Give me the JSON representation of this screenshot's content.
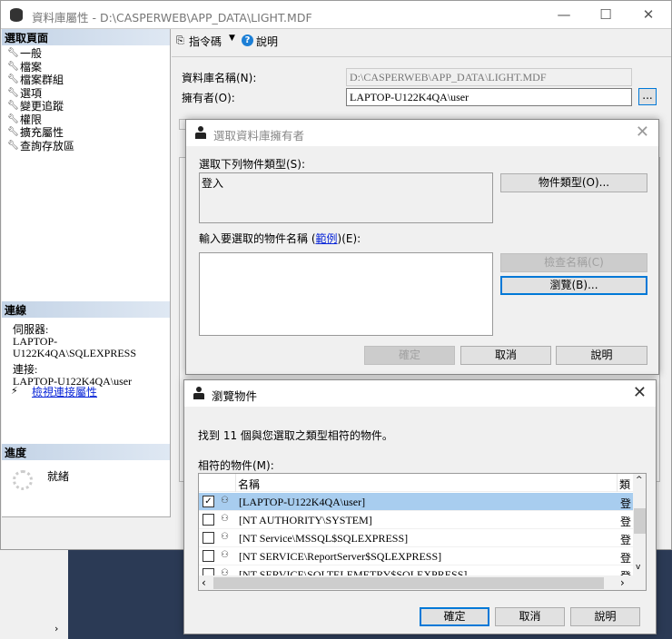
{
  "main_window": {
    "title": "資料庫屬性 - D:\\CASPERWEB\\APP_DATA\\LIGHT.MDF",
    "controls": {
      "minimize": "—",
      "maximize": "☐",
      "close": "✕"
    },
    "left_panel": {
      "select_page_header": "選取頁面",
      "pages": [
        "一般",
        "檔案",
        "檔案群組",
        "選項",
        "變更追蹤",
        "權限",
        "擴充屬性",
        "查詢存放區"
      ],
      "connection_header": "連線",
      "server_label": "伺服器:",
      "server_value": "LAPTOP-U122K4QA\\SQLEXPRESS",
      "connection_label": "連接:",
      "connection_value": "LAPTOP-U122K4QA\\user",
      "view_connection_link": "檢視連接屬性",
      "progress_header": "進度",
      "progress_status": "就緒"
    },
    "toolbar": {
      "script_label": "指令碼",
      "help_label": "說明"
    },
    "form": {
      "db_name_label": "資料庫名稱(N):",
      "db_name_value": "D:\\CASPERWEB\\APP_DATA\\LIGHT.MDF",
      "owner_label": "擁有者(O):",
      "owner_value": "LAPTOP-U122K4QA\\user",
      "browse_button": "..."
    }
  },
  "select_owner_dialog": {
    "title": "選取資料庫擁有者",
    "object_types_label": "選取下列物件類型(S):",
    "object_types_value": "登入",
    "object_types_button": "物件類型(O)...",
    "enter_names_label_pre": "輸入要選取的物件名稱 (",
    "examples_link": "範例",
    "enter_names_label_post": ")(E):",
    "check_names_button": "檢查名稱(C)",
    "browse_button": "瀏覽(B)...",
    "ok": "確定",
    "cancel": "取消",
    "help": "說明"
  },
  "browse_dialog": {
    "title": "瀏覽物件",
    "found_text": "找到 11 個與您選取之類型相符的物件。",
    "matching_label": "相符的物件(M):",
    "columns": {
      "name": "名稱",
      "type": "類"
    },
    "rows": [
      {
        "name": "[LAPTOP-U122K4QA\\user]",
        "type": "登",
        "checked": true
      },
      {
        "name": "[NT AUTHORITY\\SYSTEM]",
        "type": "登",
        "checked": false
      },
      {
        "name": "[NT Service\\MSSQL$SQLEXPRESS]",
        "type": "登",
        "checked": false
      },
      {
        "name": "[NT SERVICE\\ReportServer$SQLEXPRESS]",
        "type": "登",
        "checked": false
      },
      {
        "name": "[NT SERVICE\\SQLTELEMETRY$SQLEXPRESS]",
        "type": "登",
        "checked": false
      }
    ],
    "ok": "確定",
    "cancel": "取消",
    "help": "說明"
  }
}
